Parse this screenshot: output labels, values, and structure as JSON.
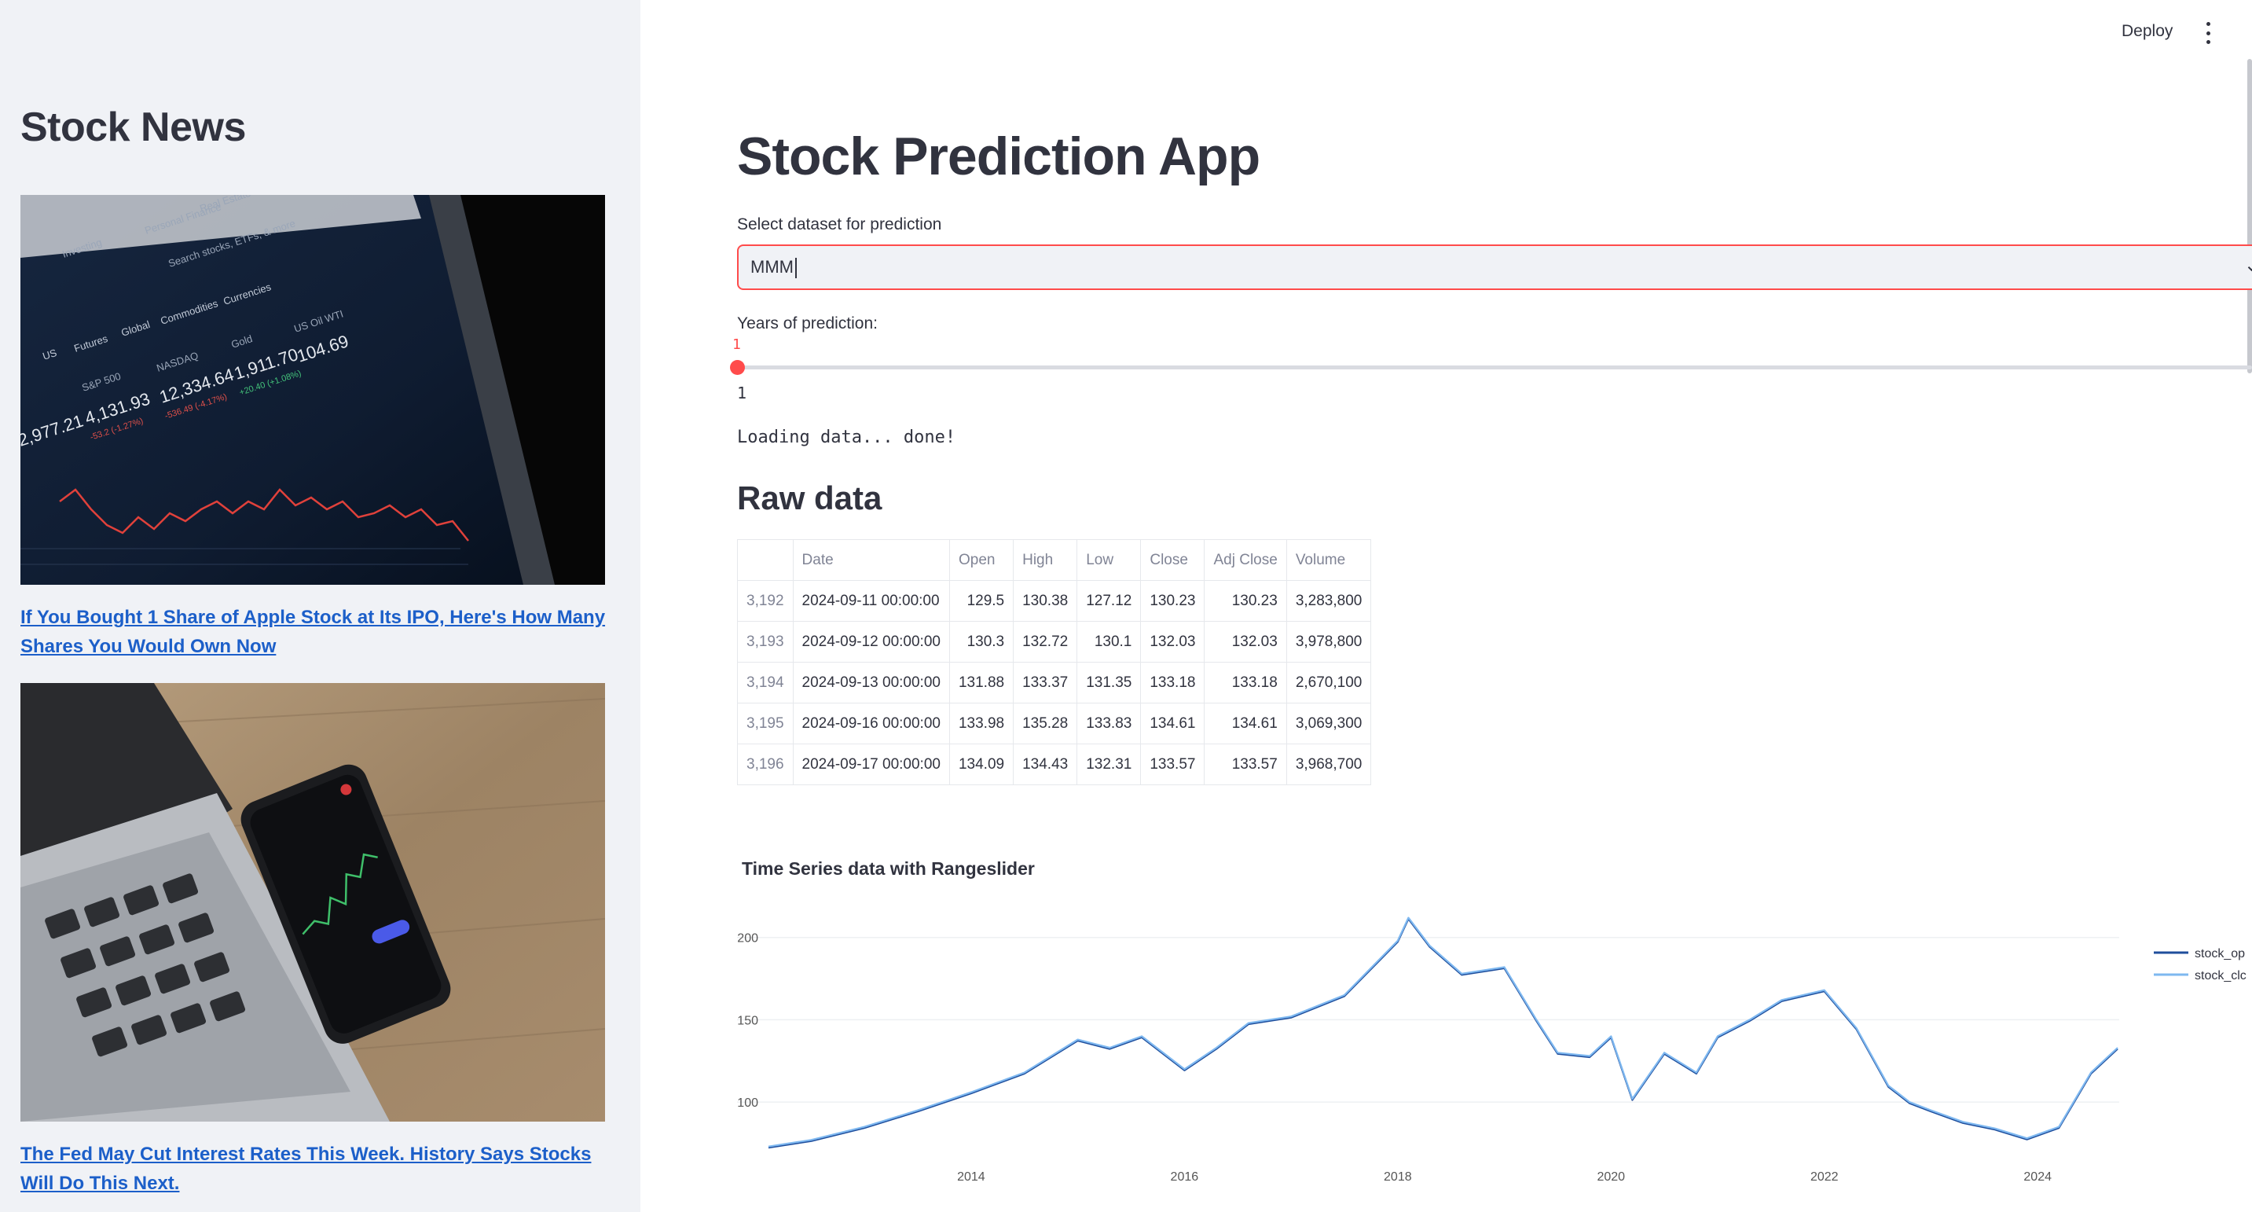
{
  "sidebar": {
    "title": "Stock News",
    "news": [
      {
        "title": "If You Bought 1 Share of Apple Stock at Its IPO, Here's How Many Shares You Would Own Now"
      },
      {
        "title": "The Fed May Cut Interest Rates This Week. History Says Stocks Will Do This Next."
      }
    ],
    "image1_text": {
      "tabs": [
        "Investing",
        "Personal Finance",
        "Real Estate"
      ],
      "search": "Search stocks, ETFs, & more",
      "categories": [
        "US",
        "Futures",
        "Global",
        "Commodities",
        "Currencies"
      ],
      "tickers": [
        {
          "name": "S&P 500",
          "value": "4,131.93",
          "change": "-53.2 (-1.27%)"
        },
        {
          "name": "NASDAQ",
          "value": "12,334.64",
          "change": "-536.49 (-4.17%)"
        },
        {
          "name": "Gold",
          "value": "1,911.70",
          "change": "+20.40 (+1.08%)"
        },
        {
          "name": "US Oil WTI",
          "value": "104.69",
          "change": ""
        }
      ],
      "left_value": "2,977.21"
    }
  },
  "header": {
    "deploy_label": "Deploy"
  },
  "main": {
    "title": "Stock Prediction App",
    "select_label": "Select dataset for prediction",
    "select_value": "MMM",
    "slider_label": "Years of prediction:",
    "slider_value": "1",
    "slider_min": "1",
    "status": "Loading data... done!",
    "raw_title": "Raw data",
    "table": {
      "columns": [
        "",
        "Date",
        "Open",
        "High",
        "Low",
        "Close",
        "Adj Close",
        "Volume"
      ],
      "rows": [
        [
          "3,192",
          "2024-09-11 00:00:00",
          "129.5",
          "130.38",
          "127.12",
          "130.23",
          "130.23",
          "3,283,800"
        ],
        [
          "3,193",
          "2024-09-12 00:00:00",
          "130.3",
          "132.72",
          "130.1",
          "132.03",
          "132.03",
          "3,978,800"
        ],
        [
          "3,194",
          "2024-09-13 00:00:00",
          "131.88",
          "133.37",
          "131.35",
          "133.18",
          "133.18",
          "2,670,100"
        ],
        [
          "3,195",
          "2024-09-16 00:00:00",
          "133.98",
          "135.28",
          "133.83",
          "134.61",
          "134.61",
          "3,069,300"
        ],
        [
          "3,196",
          "2024-09-17 00:00:00",
          "134.09",
          "134.43",
          "132.31",
          "133.57",
          "133.57",
          "3,968,700"
        ]
      ]
    }
  },
  "chart_data": {
    "type": "line",
    "title": "Time Series data with Rangeslider",
    "xlabel": "",
    "ylabel": "",
    "xlim": [
      2012.1,
      2024.75
    ],
    "ylim": [
      70,
      218
    ],
    "x_ticks": [
      "2014",
      "2016",
      "2018",
      "2020",
      "2022",
      "2024"
    ],
    "y_ticks": [
      "100",
      "150",
      "200"
    ],
    "grid": true,
    "legend_position": "top-right",
    "series": [
      {
        "name": "stock_op",
        "color": "#1f4e9c"
      },
      {
        "name": "stock_clc",
        "color": "#7eb8f0"
      }
    ],
    "x": [
      2012.1,
      2012.5,
      2013.0,
      2013.5,
      2014.0,
      2014.5,
      2015.0,
      2015.3,
      2015.6,
      2016.0,
      2016.3,
      2016.6,
      2017.0,
      2017.5,
      2018.0,
      2018.1,
      2018.3,
      2018.6,
      2019.0,
      2019.3,
      2019.5,
      2019.8,
      2020.0,
      2020.2,
      2020.5,
      2020.8,
      2021.0,
      2021.3,
      2021.6,
      2022.0,
      2022.3,
      2022.6,
      2022.8,
      2023.0,
      2023.3,
      2023.6,
      2023.9,
      2024.2,
      2024.5,
      2024.75
    ],
    "y": [
      73,
      77,
      85,
      95,
      106,
      118,
      138,
      133,
      140,
      120,
      133,
      148,
      152,
      165,
      198,
      212,
      195,
      178,
      182,
      150,
      130,
      128,
      140,
      102,
      130,
      118,
      140,
      150,
      162,
      168,
      145,
      110,
      100,
      95,
      88,
      84,
      78,
      85,
      118,
      133
    ]
  }
}
